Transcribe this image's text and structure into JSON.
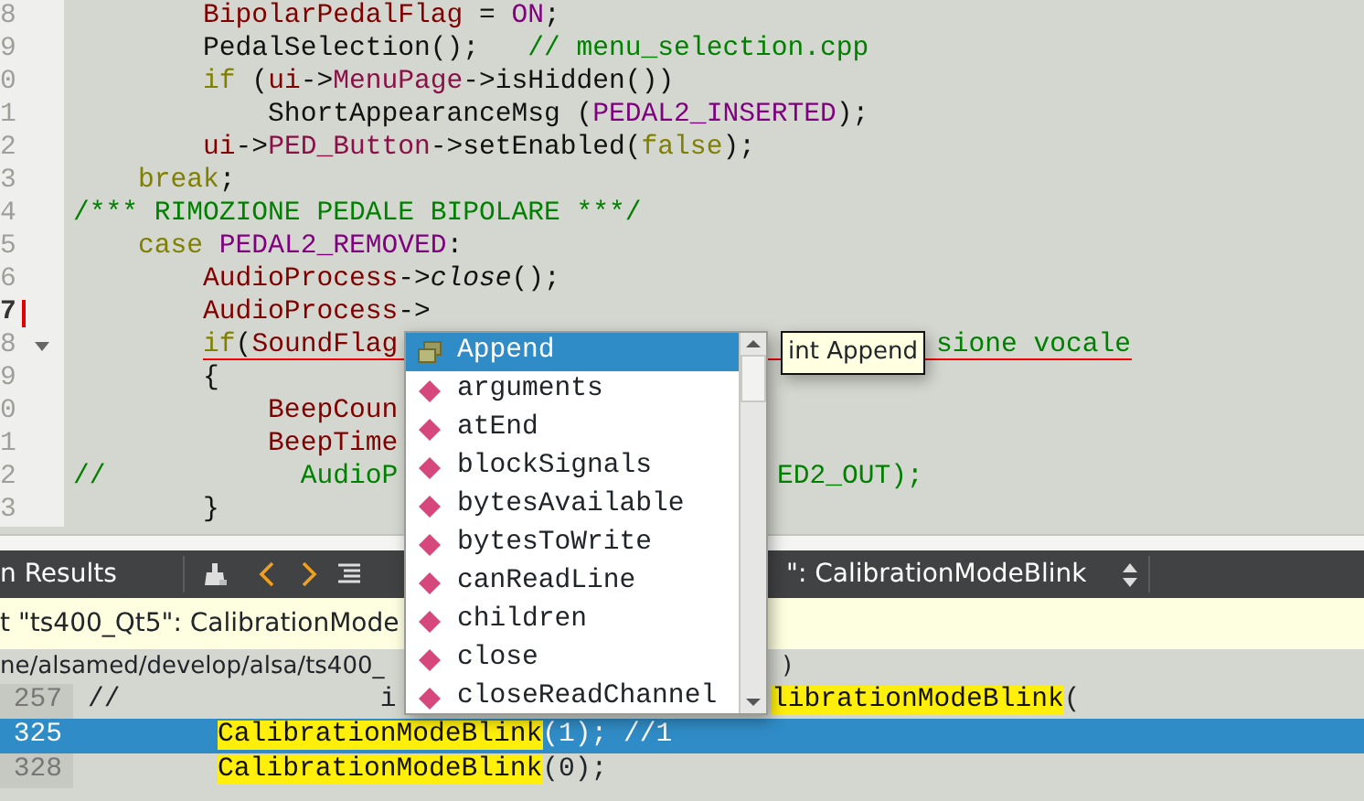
{
  "editor": {
    "lines": [
      {
        "number": "8",
        "current": false,
        "changed": false,
        "foldable": false,
        "error": false,
        "segments": [
          {
            "text": "        BipolarPedalFlag",
            "kind": "member"
          },
          {
            "text": " = ",
            "kind": "plain"
          },
          {
            "text": "ON",
            "kind": "macro"
          },
          {
            "text": ";",
            "kind": "plain"
          }
        ]
      },
      {
        "number": "9",
        "current": false,
        "changed": false,
        "foldable": false,
        "error": false,
        "segments": [
          {
            "text": "        PedalSelection();   ",
            "kind": "plain"
          },
          {
            "text": "// menu_selection.cpp",
            "kind": "comment"
          }
        ]
      },
      {
        "number": "0",
        "current": false,
        "changed": false,
        "foldable": false,
        "error": false,
        "segments": [
          {
            "text": "        if",
            "kind": "keyword"
          },
          {
            "text": " (",
            "kind": "plain"
          },
          {
            "text": "ui",
            "kind": "member"
          },
          {
            "text": "->",
            "kind": "plain"
          },
          {
            "text": "MenuPage",
            "kind": "field"
          },
          {
            "text": "->isHidden())",
            "kind": "plain"
          }
        ]
      },
      {
        "number": "1",
        "current": false,
        "changed": false,
        "foldable": false,
        "error": false,
        "segments": [
          {
            "text": "            ShortAppearanceMsg (",
            "kind": "plain"
          },
          {
            "text": "PEDAL2_INSERTED",
            "kind": "macro"
          },
          {
            "text": ");",
            "kind": "plain"
          }
        ]
      },
      {
        "number": "2",
        "current": false,
        "changed": false,
        "foldable": false,
        "error": false,
        "segments": [
          {
            "text": "        ui",
            "kind": "member"
          },
          {
            "text": "->",
            "kind": "plain"
          },
          {
            "text": "PED_Button",
            "kind": "field"
          },
          {
            "text": "->setEnabled(",
            "kind": "plain"
          },
          {
            "text": "false",
            "kind": "keyword"
          },
          {
            "text": ");",
            "kind": "plain"
          }
        ]
      },
      {
        "number": "3",
        "current": false,
        "changed": false,
        "foldable": false,
        "error": false,
        "segments": [
          {
            "text": "    break",
            "kind": "keyword"
          },
          {
            "text": ";",
            "kind": "plain"
          }
        ]
      },
      {
        "number": "4",
        "current": false,
        "changed": false,
        "foldable": false,
        "error": false,
        "segments": [
          {
            "text": "/*** RIMOZIONE PEDALE BIPOLARE ***/",
            "kind": "comment"
          }
        ]
      },
      {
        "number": "5",
        "current": false,
        "changed": false,
        "foldable": false,
        "error": false,
        "segments": [
          {
            "text": "    case",
            "kind": "keyword"
          },
          {
            "text": " PEDAL2_REMOVED",
            "kind": "macro"
          },
          {
            "text": ":",
            "kind": "plain"
          }
        ]
      },
      {
        "number": "6",
        "current": false,
        "changed": false,
        "foldable": false,
        "error": false,
        "segments": [
          {
            "text": "        AudioProcess",
            "kind": "member"
          },
          {
            "text": "->",
            "kind": "plain"
          },
          {
            "text": "close",
            "kind": "virtual"
          },
          {
            "text": "();",
            "kind": "plain"
          }
        ]
      },
      {
        "number": "7",
        "current": true,
        "changed": true,
        "foldable": false,
        "error": false,
        "segments": [
          {
            "text": "        AudioProcess",
            "kind": "member"
          },
          {
            "text": "->",
            "kind": "plain"
          }
        ]
      },
      {
        "number": "8",
        "current": false,
        "changed": false,
        "foldable": true,
        "error": true,
        "segments": [
          {
            "text": "        if",
            "kind": "keyword"
          },
          {
            "text": "(",
            "kind": "plain"
          },
          {
            "text": "SoundFlag",
            "kind": "member"
          }
        ],
        "tail": [
          {
            "text": "sione vocale",
            "kind": "comment"
          }
        ]
      },
      {
        "number": "9",
        "current": false,
        "changed": false,
        "foldable": false,
        "error": false,
        "segments": [
          {
            "text": "        {",
            "kind": "plain"
          }
        ]
      },
      {
        "number": "0",
        "current": false,
        "changed": false,
        "foldable": false,
        "error": false,
        "segments": [
          {
            "text": "            BeepCoun",
            "kind": "member"
          }
        ]
      },
      {
        "number": "1",
        "current": false,
        "changed": false,
        "foldable": false,
        "error": false,
        "segments": [
          {
            "text": "            BeepTime",
            "kind": "member"
          }
        ]
      },
      {
        "number": "2",
        "current": false,
        "changed": false,
        "foldable": false,
        "error": false,
        "segments": [
          {
            "text": "//            AudioP",
            "kind": "comment"
          }
        ],
        "tail": [
          {
            "text": "ED2_OUT);",
            "kind": "comment"
          }
        ]
      },
      {
        "number": "3",
        "current": false,
        "changed": false,
        "foldable": false,
        "error": false,
        "segments": [
          {
            "text": "        }",
            "kind": "plain"
          }
        ]
      }
    ]
  },
  "completion": {
    "items": [
      {
        "label": "Append",
        "kind": "type",
        "selected": true
      },
      {
        "label": "arguments",
        "kind": "member",
        "selected": false
      },
      {
        "label": "atEnd",
        "kind": "member",
        "selected": false
      },
      {
        "label": "blockSignals",
        "kind": "member",
        "selected": false
      },
      {
        "label": "bytesAvailable",
        "kind": "member",
        "selected": false
      },
      {
        "label": "bytesToWrite",
        "kind": "member",
        "selected": false
      },
      {
        "label": "canReadLine",
        "kind": "member",
        "selected": false
      },
      {
        "label": "children",
        "kind": "member",
        "selected": false
      },
      {
        "label": "close",
        "kind": "member",
        "selected": false
      },
      {
        "label": "closeReadChannel",
        "kind": "member",
        "selected": false
      }
    ],
    "tooltip": "int Append"
  },
  "results": {
    "title": "n Results",
    "search_combo": "\": CalibrationModeBlink",
    "info": "t \"ts400_Qt5\": CalibrationMode",
    "file": {
      "path": "ne/alsamed/develop/alsa/ts400_",
      "tail": ")"
    },
    "rows": [
      {
        "line": "257",
        "selected": false,
        "segments": [
          {
            "text": "//                i",
            "hl": false
          }
        ],
        "tail": [
          {
            "text": "librationModeBlink",
            "hl": true
          },
          {
            "text": "(",
            "hl": false
          }
        ]
      },
      {
        "line": "325",
        "selected": true,
        "segments": [
          {
            "text": "        CalibrationModeBlink",
            "hl": true
          },
          {
            "text": "(1); //1",
            "hl": false
          }
        ]
      },
      {
        "line": "328",
        "selected": false,
        "segments": [
          {
            "text": "        CalibrationModeBlink",
            "hl": true
          },
          {
            "text": "(0);",
            "hl": false
          }
        ]
      }
    ]
  }
}
